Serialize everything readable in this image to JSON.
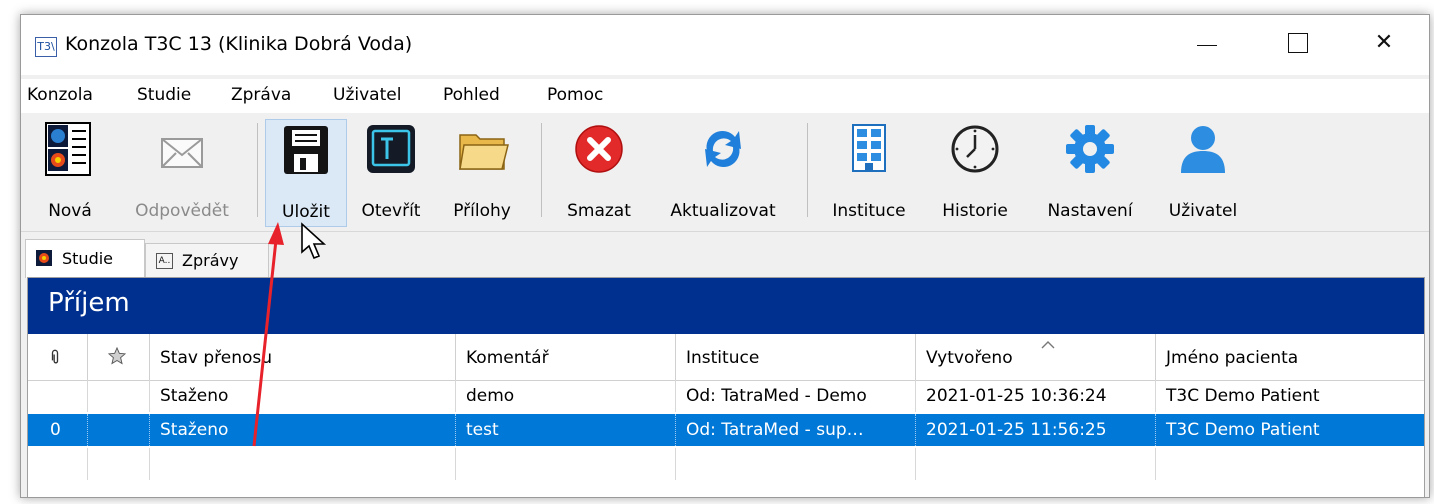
{
  "window": {
    "app_icon": "T3\\",
    "title": "Konzola T3C 13 (Klinika Dobrá Voda)",
    "controls": {
      "close": "✕"
    }
  },
  "menu": [
    "Konzola",
    "Studie",
    "Zpráva",
    "Uživatel",
    "Pohled",
    "Pomoc"
  ],
  "toolbar": {
    "buttons": [
      {
        "label": "Nová",
        "icon": "new-study-icon"
      },
      {
        "label": "Odpovědět",
        "icon": "reply-envelope-icon",
        "disabled": true
      },
      {
        "label": "Uložit",
        "icon": "floppy-disk-icon",
        "hovered": true
      },
      {
        "label": "Otevřít",
        "icon": "terminal-open-icon"
      },
      {
        "label": "Přílohy",
        "icon": "folder-icon"
      },
      {
        "label": "Smazat",
        "icon": "delete-x-icon"
      },
      {
        "label": "Aktualizovat",
        "icon": "refresh-icon"
      },
      {
        "label": "Instituce",
        "icon": "building-icon"
      },
      {
        "label": "Historie",
        "icon": "clock-icon"
      },
      {
        "label": "Nastavení",
        "icon": "gear-icon"
      },
      {
        "label": "Uživatel",
        "icon": "user-icon"
      }
    ]
  },
  "tabs": [
    {
      "label": "Studie",
      "active": true
    },
    {
      "label": "Zprávy",
      "icon_text": "A..",
      "active": false
    }
  ],
  "panel": {
    "title": "Příjem",
    "columns": [
      "",
      "",
      "Stav přenosu",
      "Komentář",
      "Instituce",
      "Vytvořeno",
      "Jméno pacienta"
    ],
    "sort_column": "Vytvořeno",
    "rows": [
      {
        "attachment": "",
        "star": "",
        "status": "Staženo",
        "comment": "demo",
        "institution": "Od: TatraMed - Demo",
        "created": "2021-01-25 10:36:24",
        "patient": "T3C Demo Patient",
        "selected": false
      },
      {
        "attachment": "0",
        "star": "",
        "status": "Staženo",
        "comment": "test",
        "institution": "Od: TatraMed - sup…",
        "created": "2021-01-25 11:56:25",
        "patient": "T3C Demo Patient",
        "selected": true
      }
    ]
  },
  "colors": {
    "banner": "#00308f",
    "selection": "#0078d7",
    "annotation_arrow": "#e8222a"
  }
}
